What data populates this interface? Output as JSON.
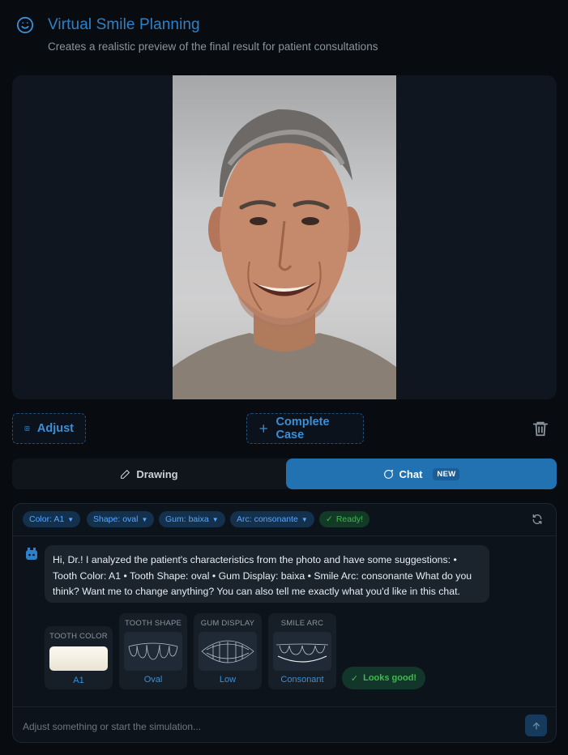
{
  "header": {
    "title": "Virtual Smile Planning",
    "subtitle": "Creates a realistic preview of the final result for patient consultations",
    "icon": "smile-icon"
  },
  "actions": {
    "adjust_label": "Adjust",
    "complete_label": "Complete Case"
  },
  "tabs": [
    {
      "label": "Drawing",
      "icon": "pencil-icon"
    },
    {
      "label": "Chat",
      "icon": "chat-icon",
      "badge": "NEW"
    }
  ],
  "chips": [
    {
      "label": "Color: A1"
    },
    {
      "label": "Shape: oval"
    },
    {
      "label": "Gum: baixa"
    },
    {
      "label": "Arc: consonante"
    }
  ],
  "status_chip": "Ready!",
  "message": "Hi, Dr.! I analyzed the patient's characteristics from the photo and have some suggestions: • Tooth Color: A1 • Tooth Shape: oval • Gum Display: baixa • Smile Arc: consonante What do you think? Want me to change anything? You can also tell me exactly what you'd like in this chat.",
  "options": {
    "tooth_color": {
      "title": "TOOTH COLOR",
      "value": "A1"
    },
    "tooth_shape": {
      "title": "TOOTH SHAPE",
      "value": "Oval"
    },
    "gum_display": {
      "title": "GUM DISPLAY",
      "value": "Low"
    },
    "smile_arc": {
      "title": "SMILE ARC",
      "value": "Consonant"
    }
  },
  "confirm_label": "Looks good!",
  "input": {
    "placeholder": "Adjust something or start the simulation..."
  },
  "colors": {
    "accent": "#2272b2",
    "link": "#3b8fd6",
    "success": "#3fb950",
    "background": "#080b10"
  }
}
